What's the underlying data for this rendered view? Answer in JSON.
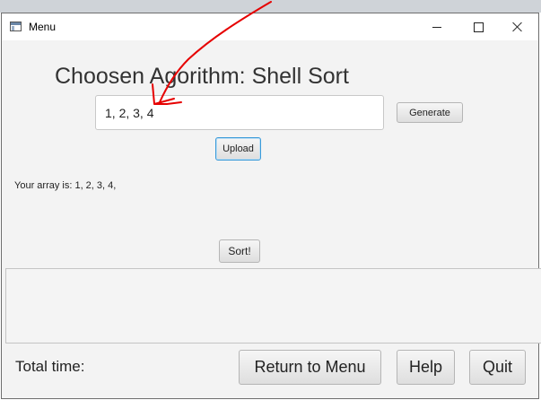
{
  "window": {
    "title": "Menu"
  },
  "main": {
    "heading": "Choosen Agorithm: Shell Sort",
    "array_input_value": "1, 2, 3, 4",
    "generate_label": "Generate",
    "upload_label": "Upload",
    "array_summary": "Your array is:  1, 2, 3, 4,",
    "sort_label": "Sort!",
    "output_text": ""
  },
  "footer": {
    "total_time_label": "Total time:",
    "return_label": "Return to Menu",
    "help_label": "Help",
    "quit_label": "Quit"
  },
  "colors": {
    "window_bg": "#f3f3f3",
    "focus_border": "#3a9ad9",
    "annotation_stroke": "#e60000"
  },
  "icons": [
    "app-window-icon",
    "minimize-icon",
    "maximize-icon",
    "close-icon"
  ]
}
